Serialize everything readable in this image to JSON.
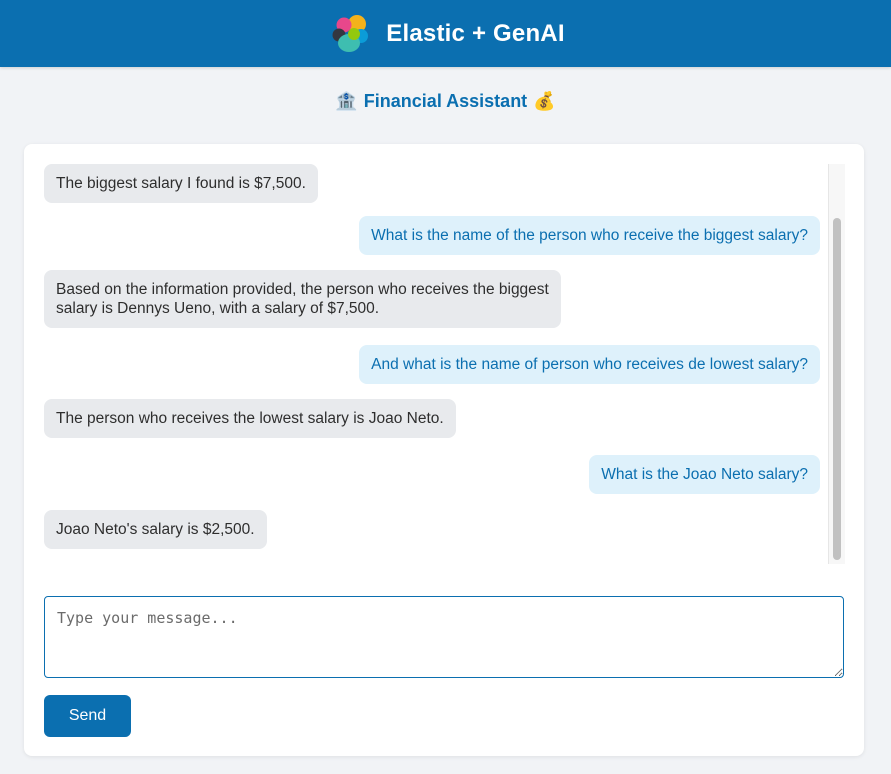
{
  "header": {
    "title": "Elastic + GenAI",
    "logo_icon": "elastic-logo-icon",
    "background": "#0b6fb0"
  },
  "assistant": {
    "title": "Financial Assistant",
    "leading_emoji": "🏦",
    "trailing_emoji": "💰"
  },
  "messages": [
    {
      "role": "assistant",
      "text": "The biggest salary I found is $7,500."
    },
    {
      "role": "user",
      "text": "What is the name of the person who receive the biggest salary?"
    },
    {
      "role": "assistant",
      "text": "Based on the information provided, the person who receives the biggest\nsalary is Dennys Ueno, with a salary of $7,500."
    },
    {
      "role": "user",
      "text": "And what is the name of person who receives de lowest salary?"
    },
    {
      "role": "assistant",
      "text": "The person who receives the lowest salary is Joao Neto."
    },
    {
      "role": "user",
      "text": "What is the Joao Neto salary?"
    },
    {
      "role": "assistant",
      "text": "Joao Neto's salary is $2,500."
    }
  ],
  "input": {
    "placeholder": "Type your message...",
    "value": ""
  },
  "send_button": {
    "label": "Send"
  },
  "colors": {
    "accent": "#0b6fb0",
    "assistant_bubble": "#e8eaed",
    "user_bubble": "#def1fb"
  }
}
